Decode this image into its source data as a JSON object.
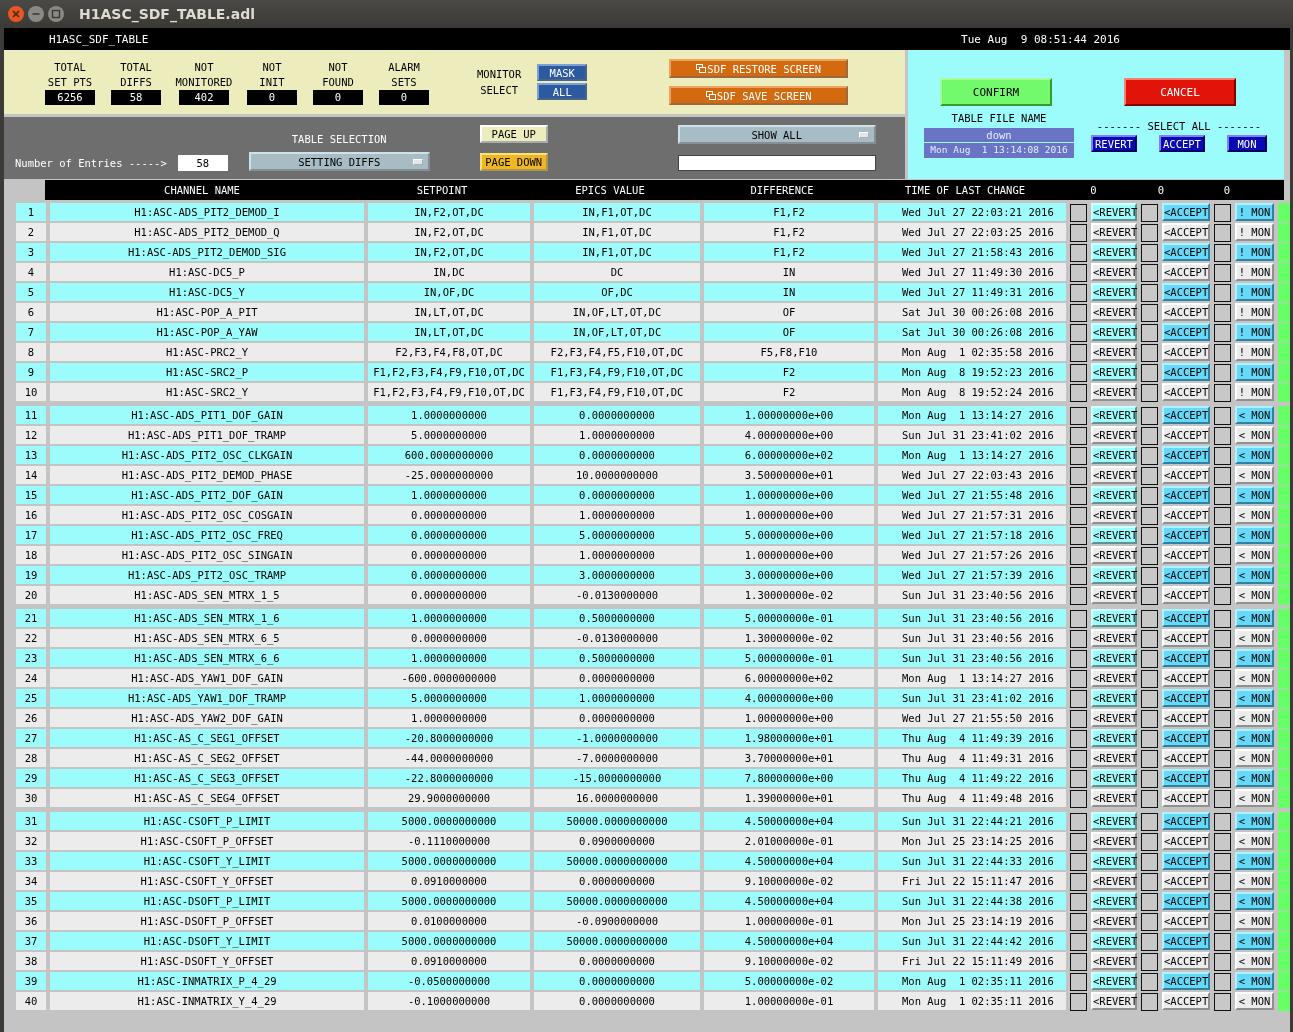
{
  "window": {
    "title": "H1ASC_SDF_TABLE.adl"
  },
  "banner": {
    "screen_name": "H1ASC_SDF_TABLE",
    "clock": "Tue Aug  9 08:51:44 2016"
  },
  "stats": [
    {
      "label": [
        "TOTAL",
        "SET PTS"
      ],
      "value": "6256"
    },
    {
      "label": [
        "TOTAL",
        "DIFFS"
      ],
      "value": "58"
    },
    {
      "label": [
        "NOT",
        "MONITORED"
      ],
      "value": "402"
    },
    {
      "label": [
        "NOT",
        "INIT"
      ],
      "value": "0"
    },
    {
      "label": [
        "NOT",
        "FOUND"
      ],
      "value": "0"
    },
    {
      "label": [
        "ALARM",
        "SETS"
      ],
      "value": "0"
    }
  ],
  "monitor_select": {
    "label": [
      "MONITOR",
      "SELECT"
    ],
    "buttons": [
      "MASK",
      "ALL"
    ]
  },
  "screen_buttons": [
    "SDF RESTORE SCREEN",
    "SDF SAVE SCREEN"
  ],
  "entries": {
    "label": "Number of Entries ----->",
    "value": "58"
  },
  "table_selection": {
    "label": "TABLE SELECTION",
    "value": "SETTING DIFFS"
  },
  "paging": {
    "up": "PAGE UP",
    "down": "PAGE DOWN"
  },
  "filter": {
    "value": "SHOW ALL"
  },
  "confirm": "CONFIRM",
  "cancel": "CANCEL",
  "table_file": {
    "label": "TABLE FILE NAME",
    "name": "down",
    "time": "Mon Aug  1 13:14:08 2016"
  },
  "select_all": {
    "label": "------- SELECT ALL -------",
    "buttons": [
      "REVERT",
      "ACCEPT",
      "MON"
    ]
  },
  "columns": [
    "CHANNEL NAME",
    "SETPOINT",
    "EPICS VALUE",
    "DIFFERENCE",
    "TIME OF LAST CHANGE",
    "0",
    "0",
    "0"
  ],
  "groups": [
    {
      "rows": [
        {
          "n": "1",
          "channel": "H1:ASC-ADS_PIT2_DEMOD_I",
          "setpoint": "IN,F2,OT,DC",
          "epics": "IN,F1,OT,DC",
          "diff": "F1,F2",
          "time": "Wed Jul 27 22:03:21 2016",
          "revert": "<REVERT",
          "accept": "<ACCEPT",
          "mon": "! MON",
          "revert_checked": false,
          "accept_checked": false,
          "mon_checked": false
        },
        {
          "n": "2",
          "channel": "H1:ASC-ADS_PIT2_DEMOD_Q",
          "setpoint": "IN,F2,OT,DC",
          "epics": "IN,F1,OT,DC",
          "diff": "F1,F2",
          "time": "Wed Jul 27 22:03:25 2016",
          "revert": "<REVERT",
          "accept": "<ACCEPT",
          "mon": "! MON",
          "revert_checked": false,
          "accept_checked": false,
          "mon_checked": false
        },
        {
          "n": "3",
          "channel": "H1:ASC-ADS_PIT2_DEMOD_SIG",
          "setpoint": "IN,F2,OT,DC",
          "epics": "IN,F1,OT,DC",
          "diff": "F1,F2",
          "time": "Wed Jul 27 21:58:43 2016",
          "revert": "<REVERT",
          "accept": "<ACCEPT",
          "mon": "! MON",
          "revert_checked": false,
          "accept_checked": false,
          "mon_checked": false
        },
        {
          "n": "4",
          "channel": "H1:ASC-DC5_P",
          "setpoint": "IN,DC",
          "epics": "DC",
          "diff": "IN",
          "time": "Wed Jul 27 11:49:30 2016",
          "revert": "<REVERT",
          "accept": "<ACCEPT",
          "mon": "! MON",
          "revert_checked": false,
          "accept_checked": false,
          "mon_checked": false
        },
        {
          "n": "5",
          "channel": "H1:ASC-DC5_Y",
          "setpoint": "IN,OF,DC",
          "epics": "OF,DC",
          "diff": "IN",
          "time": "Wed Jul 27 11:49:31 2016",
          "revert": "<REVERT",
          "accept": "<ACCEPT",
          "mon": "! MON",
          "revert_checked": false,
          "accept_checked": false,
          "mon_checked": false
        },
        {
          "n": "6",
          "channel": "H1:ASC-POP_A_PIT",
          "setpoint": "IN,LT,OT,DC",
          "epics": "IN,OF,LT,OT,DC",
          "diff": "OF",
          "time": "Sat Jul 30 00:26:08 2016",
          "revert": "<REVERT",
          "accept": "<ACCEPT",
          "mon": "! MON",
          "revert_checked": false,
          "accept_checked": false,
          "mon_checked": false
        },
        {
          "n": "7",
          "channel": "H1:ASC-POP_A_YAW",
          "setpoint": "IN,LT,OT,DC",
          "epics": "IN,OF,LT,OT,DC",
          "diff": "OF",
          "time": "Sat Jul 30 00:26:08 2016",
          "revert": "<REVERT",
          "accept": "<ACCEPT",
          "mon": "! MON",
          "revert_checked": false,
          "accept_checked": false,
          "mon_checked": false
        },
        {
          "n": "8",
          "channel": "H1:ASC-PRC2_Y",
          "setpoint": "F2,F3,F4,F8,OT,DC",
          "epics": "F2,F3,F4,F5,F10,OT,DC",
          "diff": "F5,F8,F10",
          "time": "Mon Aug  1 02:35:58 2016",
          "revert": "<REVERT",
          "accept": "<ACCEPT",
          "mon": "! MON",
          "revert_checked": false,
          "accept_checked": false,
          "mon_checked": false
        },
        {
          "n": "9",
          "channel": "H1:ASC-SRC2_P",
          "setpoint": "F1,F2,F3,F4,F9,F10,OT,DC",
          "epics": "F1,F3,F4,F9,F10,OT,DC",
          "diff": "F2",
          "time": "Mon Aug  8 19:52:23 2016",
          "revert": "<REVERT",
          "accept": "<ACCEPT",
          "mon": "! MON",
          "revert_checked": false,
          "accept_checked": false,
          "mon_checked": false
        },
        {
          "n": "10",
          "channel": "H1:ASC-SRC2_Y",
          "setpoint": "F1,F2,F3,F4,F9,F10,OT,DC",
          "epics": "F1,F3,F4,F9,F10,OT,DC",
          "diff": "F2",
          "time": "Mon Aug  8 19:52:24 2016",
          "revert": "<REVERT",
          "accept": "<ACCEPT",
          "mon": "! MON",
          "revert_checked": false,
          "accept_checked": false,
          "mon_checked": false
        }
      ]
    },
    {
      "rows": [
        {
          "n": "11",
          "channel": "H1:ASC-ADS_PIT1_DOF_GAIN",
          "setpoint": "1.0000000000",
          "epics": "0.0000000000",
          "diff": "1.00000000e+00",
          "time": "Mon Aug  1 13:14:27 2016",
          "revert": "<REVERT",
          "accept": "<ACCEPT",
          "mon": "< MON",
          "revert_checked": false,
          "accept_checked": false,
          "mon_checked": false
        },
        {
          "n": "12",
          "channel": "H1:ASC-ADS_PIT1_DOF_TRAMP",
          "setpoint": "5.0000000000",
          "epics": "1.0000000000",
          "diff": "4.00000000e+00",
          "time": "Sun Jul 31 23:41:02 2016",
          "revert": "<REVERT",
          "accept": "<ACCEPT",
          "mon": "< MON",
          "revert_checked": false,
          "accept_checked": false,
          "mon_checked": false
        },
        {
          "n": "13",
          "channel": "H1:ASC-ADS_PIT2_OSC_CLKGAIN",
          "setpoint": "600.0000000000",
          "epics": "0.0000000000",
          "diff": "6.00000000e+02",
          "time": "Mon Aug  1 13:14:27 2016",
          "revert": "<REVERT",
          "accept": "<ACCEPT",
          "mon": "< MON",
          "revert_checked": false,
          "accept_checked": false,
          "mon_checked": false
        },
        {
          "n": "14",
          "channel": "H1:ASC-ADS_PIT2_DEMOD_PHASE",
          "setpoint": "-25.0000000000",
          "epics": "10.0000000000",
          "diff": "3.50000000e+01",
          "time": "Wed Jul 27 22:03:43 2016",
          "revert": "<REVERT",
          "accept": "<ACCEPT",
          "mon": "< MON",
          "revert_checked": false,
          "accept_checked": false,
          "mon_checked": false
        },
        {
          "n": "15",
          "channel": "H1:ASC-ADS_PIT2_DOF_GAIN",
          "setpoint": "1.0000000000",
          "epics": "0.0000000000",
          "diff": "1.00000000e+00",
          "time": "Wed Jul 27 21:55:48 2016",
          "revert": "<REVERT",
          "accept": "<ACCEPT",
          "mon": "< MON",
          "revert_checked": false,
          "accept_checked": false,
          "mon_checked": false
        },
        {
          "n": "16",
          "channel": "H1:ASC-ADS_PIT2_OSC_COSGAIN",
          "setpoint": "0.0000000000",
          "epics": "1.0000000000",
          "diff": "1.00000000e+00",
          "time": "Wed Jul 27 21:57:31 2016",
          "revert": "<REVERT",
          "accept": "<ACCEPT",
          "mon": "< MON",
          "revert_checked": false,
          "accept_checked": false,
          "mon_checked": false
        },
        {
          "n": "17",
          "channel": "H1:ASC-ADS_PIT2_OSC_FREQ",
          "setpoint": "0.0000000000",
          "epics": "5.0000000000",
          "diff": "5.00000000e+00",
          "time": "Wed Jul 27 21:57:18 2016",
          "revert": "<REVERT",
          "accept": "<ACCEPT",
          "mon": "< MON",
          "revert_checked": false,
          "accept_checked": false,
          "mon_checked": false
        },
        {
          "n": "18",
          "channel": "H1:ASC-ADS_PIT2_OSC_SINGAIN",
          "setpoint": "0.0000000000",
          "epics": "1.0000000000",
          "diff": "1.00000000e+00",
          "time": "Wed Jul 27 21:57:26 2016",
          "revert": "<REVERT",
          "accept": "<ACCEPT",
          "mon": "< MON",
          "revert_checked": false,
          "accept_checked": false,
          "mon_checked": false
        },
        {
          "n": "19",
          "channel": "H1:ASC-ADS_PIT2_OSC_TRAMP",
          "setpoint": "0.0000000000",
          "epics": "3.0000000000",
          "diff": "3.00000000e+00",
          "time": "Wed Jul 27 21:57:39 2016",
          "revert": "<REVERT",
          "accept": "<ACCEPT",
          "mon": "< MON",
          "revert_checked": false,
          "accept_checked": false,
          "mon_checked": false
        },
        {
          "n": "20",
          "channel": "H1:ASC-ADS_SEN_MTRX_1_5",
          "setpoint": "0.0000000000",
          "epics": "-0.0130000000",
          "diff": "1.30000000e-02",
          "time": "Sun Jul 31 23:40:56 2016",
          "revert": "<REVERT",
          "accept": "<ACCEPT",
          "mon": "< MON",
          "revert_checked": false,
          "accept_checked": false,
          "mon_checked": false
        }
      ]
    },
    {
      "rows": [
        {
          "n": "21",
          "channel": "H1:ASC-ADS_SEN_MTRX_1_6",
          "setpoint": "1.0000000000",
          "epics": "0.5000000000",
          "diff": "5.00000000e-01",
          "time": "Sun Jul 31 23:40:56 2016",
          "revert": "<REVERT",
          "accept": "<ACCEPT",
          "mon": "< MON",
          "revert_checked": false,
          "accept_checked": false,
          "mon_checked": false
        },
        {
          "n": "22",
          "channel": "H1:ASC-ADS_SEN_MTRX_6_5",
          "setpoint": "0.0000000000",
          "epics": "-0.0130000000",
          "diff": "1.30000000e-02",
          "time": "Sun Jul 31 23:40:56 2016",
          "revert": "<REVERT",
          "accept": "<ACCEPT",
          "mon": "< MON",
          "revert_checked": false,
          "accept_checked": false,
          "mon_checked": false
        },
        {
          "n": "23",
          "channel": "H1:ASC-ADS_SEN_MTRX_6_6",
          "setpoint": "1.0000000000",
          "epics": "0.5000000000",
          "diff": "5.00000000e-01",
          "time": "Sun Jul 31 23:40:56 2016",
          "revert": "<REVERT",
          "accept": "<ACCEPT",
          "mon": "< MON",
          "revert_checked": false,
          "accept_checked": false,
          "mon_checked": false
        },
        {
          "n": "24",
          "channel": "H1:ASC-ADS_YAW1_DOF_GAIN",
          "setpoint": "-600.0000000000",
          "epics": "0.0000000000",
          "diff": "6.00000000e+02",
          "time": "Mon Aug  1 13:14:27 2016",
          "revert": "<REVERT",
          "accept": "<ACCEPT",
          "mon": "< MON",
          "revert_checked": false,
          "accept_checked": false,
          "mon_checked": false
        },
        {
          "n": "25",
          "channel": "H1:ASC-ADS_YAW1_DOF_TRAMP",
          "setpoint": "5.0000000000",
          "epics": "1.0000000000",
          "diff": "4.00000000e+00",
          "time": "Sun Jul 31 23:41:02 2016",
          "revert": "<REVERT",
          "accept": "<ACCEPT",
          "mon": "< MON",
          "revert_checked": false,
          "accept_checked": false,
          "mon_checked": false
        },
        {
          "n": "26",
          "channel": "H1:ASC-ADS_YAW2_DOF_GAIN",
          "setpoint": "1.0000000000",
          "epics": "0.0000000000",
          "diff": "1.00000000e+00",
          "time": "Wed Jul 27 21:55:50 2016",
          "revert": "<REVERT",
          "accept": "<ACCEPT",
          "mon": "< MON",
          "revert_checked": false,
          "accept_checked": false,
          "mon_checked": false
        },
        {
          "n": "27",
          "channel": "H1:ASC-AS_C_SEG1_OFFSET",
          "setpoint": "-20.8000000000",
          "epics": "-1.0000000000",
          "diff": "1.98000000e+01",
          "time": "Thu Aug  4 11:49:39 2016",
          "revert": "<REVERT",
          "accept": "<ACCEPT",
          "mon": "< MON",
          "revert_checked": false,
          "accept_checked": false,
          "mon_checked": false
        },
        {
          "n": "28",
          "channel": "H1:ASC-AS_C_SEG2_OFFSET",
          "setpoint": "-44.0000000000",
          "epics": "-7.0000000000",
          "diff": "3.70000000e+01",
          "time": "Thu Aug  4 11:49:31 2016",
          "revert": "<REVERT",
          "accept": "<ACCEPT",
          "mon": "< MON",
          "revert_checked": false,
          "accept_checked": false,
          "mon_checked": false
        },
        {
          "n": "29",
          "channel": "H1:ASC-AS_C_SEG3_OFFSET",
          "setpoint": "-22.8000000000",
          "epics": "-15.0000000000",
          "diff": "7.80000000e+00",
          "time": "Thu Aug  4 11:49:22 2016",
          "revert": "<REVERT",
          "accept": "<ACCEPT",
          "mon": "< MON",
          "revert_checked": false,
          "accept_checked": false,
          "mon_checked": false
        },
        {
          "n": "30",
          "channel": "H1:ASC-AS_C_SEG4_OFFSET",
          "setpoint": "29.9000000000",
          "epics": "16.0000000000",
          "diff": "1.39000000e+01",
          "time": "Thu Aug  4 11:49:48 2016",
          "revert": "<REVERT",
          "accept": "<ACCEPT",
          "mon": "< MON",
          "revert_checked": false,
          "accept_checked": false,
          "mon_checked": false
        }
      ]
    },
    {
      "rows": [
        {
          "n": "31",
          "channel": "H1:ASC-CSOFT_P_LIMIT",
          "setpoint": "5000.0000000000",
          "epics": "50000.0000000000",
          "diff": "4.50000000e+04",
          "time": "Sun Jul 31 22:44:21 2016",
          "revert": "<REVERT",
          "accept": "<ACCEPT",
          "mon": "< MON",
          "revert_checked": false,
          "accept_checked": false,
          "mon_checked": false
        },
        {
          "n": "32",
          "channel": "H1:ASC-CSOFT_P_OFFSET",
          "setpoint": "-0.1110000000",
          "epics": "0.0900000000",
          "diff": "2.01000000e-01",
          "time": "Mon Jul 25 23:14:25 2016",
          "revert": "<REVERT",
          "accept": "<ACCEPT",
          "mon": "< MON",
          "revert_checked": false,
          "accept_checked": false,
          "mon_checked": false
        },
        {
          "n": "33",
          "channel": "H1:ASC-CSOFT_Y_LIMIT",
          "setpoint": "5000.0000000000",
          "epics": "50000.0000000000",
          "diff": "4.50000000e+04",
          "time": "Sun Jul 31 22:44:33 2016",
          "revert": "<REVERT",
          "accept": "<ACCEPT",
          "mon": "< MON",
          "revert_checked": false,
          "accept_checked": false,
          "mon_checked": false
        },
        {
          "n": "34",
          "channel": "H1:ASC-CSOFT_Y_OFFSET",
          "setpoint": "0.0910000000",
          "epics": "0.0000000000",
          "diff": "9.10000000e-02",
          "time": "Fri Jul 22 15:11:47 2016",
          "revert": "<REVERT",
          "accept": "<ACCEPT",
          "mon": "< MON",
          "revert_checked": false,
          "accept_checked": false,
          "mon_checked": false
        },
        {
          "n": "35",
          "channel": "H1:ASC-DSOFT_P_LIMIT",
          "setpoint": "5000.0000000000",
          "epics": "50000.0000000000",
          "diff": "4.50000000e+04",
          "time": "Sun Jul 31 22:44:38 2016",
          "revert": "<REVERT",
          "accept": "<ACCEPT",
          "mon": "< MON",
          "revert_checked": false,
          "accept_checked": false,
          "mon_checked": false
        },
        {
          "n": "36",
          "channel": "H1:ASC-DSOFT_P_OFFSET",
          "setpoint": "0.0100000000",
          "epics": "-0.0900000000",
          "diff": "1.00000000e-01",
          "time": "Mon Jul 25 23:14:19 2016",
          "revert": "<REVERT",
          "accept": "<ACCEPT",
          "mon": "< MON",
          "revert_checked": false,
          "accept_checked": false,
          "mon_checked": false
        },
        {
          "n": "37",
          "channel": "H1:ASC-DSOFT_Y_LIMIT",
          "setpoint": "5000.0000000000",
          "epics": "50000.0000000000",
          "diff": "4.50000000e+04",
          "time": "Sun Jul 31 22:44:42 2016",
          "revert": "<REVERT",
          "accept": "<ACCEPT",
          "mon": "< MON",
          "revert_checked": false,
          "accept_checked": false,
          "mon_checked": false
        },
        {
          "n": "38",
          "channel": "H1:ASC-DSOFT_Y_OFFSET",
          "setpoint": "0.0910000000",
          "epics": "0.0000000000",
          "diff": "9.10000000e-02",
          "time": "Fri Jul 22 15:11:49 2016",
          "revert": "<REVERT",
          "accept": "<ACCEPT",
          "mon": "< MON",
          "revert_checked": false,
          "accept_checked": false,
          "mon_checked": false
        },
        {
          "n": "39",
          "channel": "H1:ASC-INMATRIX_P_4_29",
          "setpoint": "-0.0500000000",
          "epics": "0.0000000000",
          "diff": "5.00000000e-02",
          "time": "Mon Aug  1 02:35:11 2016",
          "revert": "<REVERT",
          "accept": "<ACCEPT",
          "mon": "< MON",
          "revert_checked": false,
          "accept_checked": false,
          "mon_checked": false
        },
        {
          "n": "40",
          "channel": "H1:ASC-INMATRIX_Y_4_29",
          "setpoint": "-0.1000000000",
          "epics": "0.0000000000",
          "diff": "1.00000000e-01",
          "time": "Mon Aug  1 02:35:11 2016",
          "revert": "<REVERT",
          "accept": "<ACCEPT",
          "mon": "< MON",
          "revert_checked": false,
          "accept_checked": false,
          "mon_checked": false
        }
      ]
    }
  ]
}
